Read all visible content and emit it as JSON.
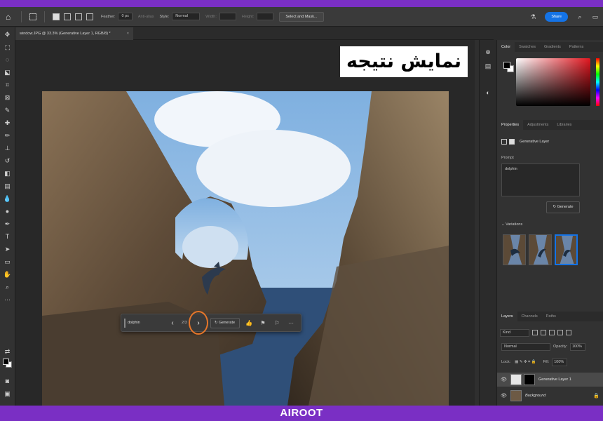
{
  "options_bar": {
    "feather_label": "Feather:",
    "feather_value": "0 px",
    "antialias_label": "Anti-alias",
    "style_label": "Style:",
    "style_value": "Normal",
    "width_label": "Width:",
    "height_label": "Height:",
    "select_mask_button": "Select and Mask...",
    "share_button": "Share"
  },
  "document": {
    "tab_title": "window.JPG @ 33.3% (Generative Layer 1, RGB/8) *",
    "close_glyph": "×"
  },
  "overlay": {
    "title": "نمایش نتیجه"
  },
  "task_bar": {
    "prompt": "dolphin",
    "count": "2/3",
    "prev_glyph": "‹",
    "next_glyph": "›",
    "generate_label": "Generate",
    "more_glyph": "···"
  },
  "color_panel": {
    "tabs": [
      "Color",
      "Swatches",
      "Gradients",
      "Patterns"
    ],
    "accent": "#e2161f"
  },
  "properties_panel": {
    "tabs": [
      "Properties",
      "Adjustments",
      "Libraries"
    ],
    "layer_type": "Generative Layer",
    "prompt_label": "Prompt",
    "prompt_value": "dolphin",
    "generate_button": "Generate",
    "variations_label": "Variations",
    "selected_variation": 3
  },
  "layers_panel": {
    "tabs": [
      "Layers",
      "Channels",
      "Paths"
    ],
    "kind_filter": "Kind",
    "blend_mode": "Normal",
    "opacity_label": "Opacity:",
    "opacity_value": "100%",
    "lock_label": "Lock:",
    "fill_label": "Fill:",
    "fill_value": "100%",
    "layers": [
      {
        "name": "Generative Layer 1"
      },
      {
        "name": "Background"
      }
    ]
  },
  "brand": {
    "text": "AIROOT"
  },
  "colors": {
    "frame": "#7a2fc4",
    "share": "#1473e6",
    "highlight_ring": "#e6762a"
  }
}
